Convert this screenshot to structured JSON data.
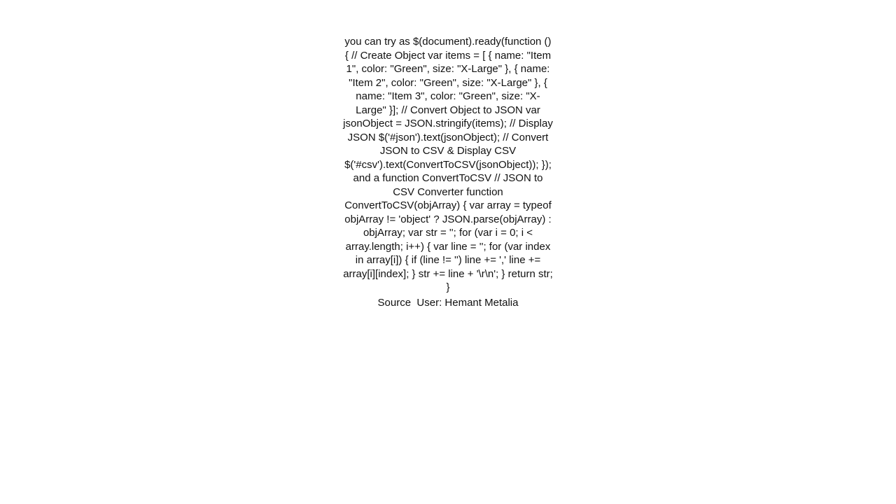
{
  "body_text": "you can try as $(document).ready(function () {          // Create Object         var items = [               { name: \"Item 1\", color: \"Green\", size: \"X-Large\" },               { name: \"Item 2\", color: \"Green\", size: \"X-Large\" },               { name: \"Item 3\", color: \"Green\", size: \"X-Large\" }];          // Convert Object to JSON         var jsonObject = JSON.stringify(items);           // Display JSON             $('#json').text(jsonObject);           // Convert JSON to CSV & Display CSV             $('#csv').text(ConvertToCSV(jsonObject));     });  and a function ConvertToCSV // JSON to CSV Converter         function ConvertToCSV(objArray) {             var array = typeof objArray != 'object' ? JSON.parse(objArray) : objArray;             var str = '';              for (var i = 0; i < array.length; i++) {                 var line = '';                 for (var index in array[i]) {                     if (line != '') line += ','                      line += array[i][index];                 }                  str += line + '\\r\\n';             }              return str;         }",
  "source_label": "Source",
  "user_label": "User: Hemant Metalia"
}
